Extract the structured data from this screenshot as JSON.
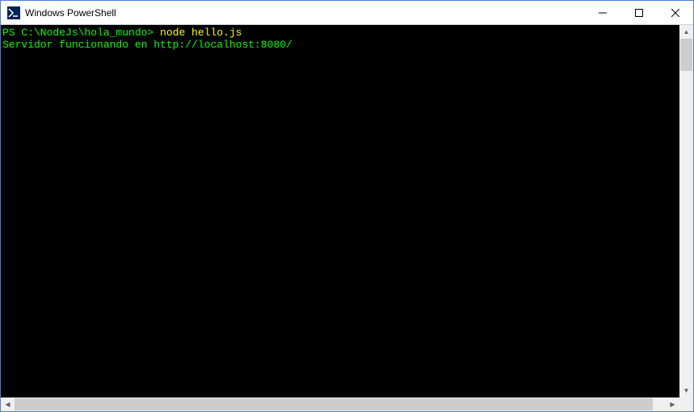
{
  "window": {
    "title": "Windows PowerShell"
  },
  "terminal": {
    "prompt": "PS C:\\NodeJs\\hola_mundo> ",
    "command": "node hello.js",
    "output": "Servidor funcionando en http://localhost:8080/"
  },
  "colors": {
    "prompt": "#00ff00",
    "command": "#ffff00",
    "output": "#00ff00",
    "background": "#000000"
  }
}
